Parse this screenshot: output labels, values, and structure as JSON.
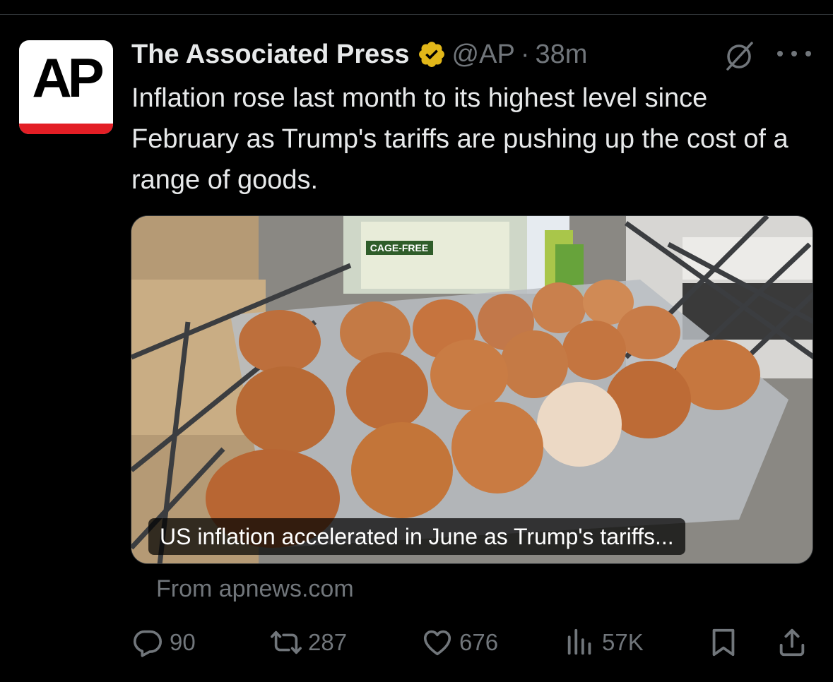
{
  "author": {
    "name": "The Associated Press",
    "handle": "@AP",
    "separator": "·",
    "time": "38m",
    "avatar_text": "AP",
    "verified_color": "#e2b719"
  },
  "tweet": {
    "text": "Inflation rose last month to its highest level since February as Trump's tariffs are pushing up the cost of a range of goods."
  },
  "card": {
    "caption": "US inflation accelerated in June as Trump's tariffs...",
    "source": "From apnews.com",
    "photo_label": "CAGE-FREE"
  },
  "actions": {
    "replies": "90",
    "reposts": "287",
    "likes": "676",
    "views": "57K"
  },
  "icons": [
    "verified-badge-icon",
    "grok-icon",
    "more-icon",
    "reply-icon",
    "repost-icon",
    "like-icon",
    "views-icon",
    "bookmark-icon",
    "share-icon"
  ],
  "colors": {
    "background": "#000000",
    "text": "#e7e9ea",
    "muted": "#71767b",
    "ap_red": "#e31e25"
  }
}
